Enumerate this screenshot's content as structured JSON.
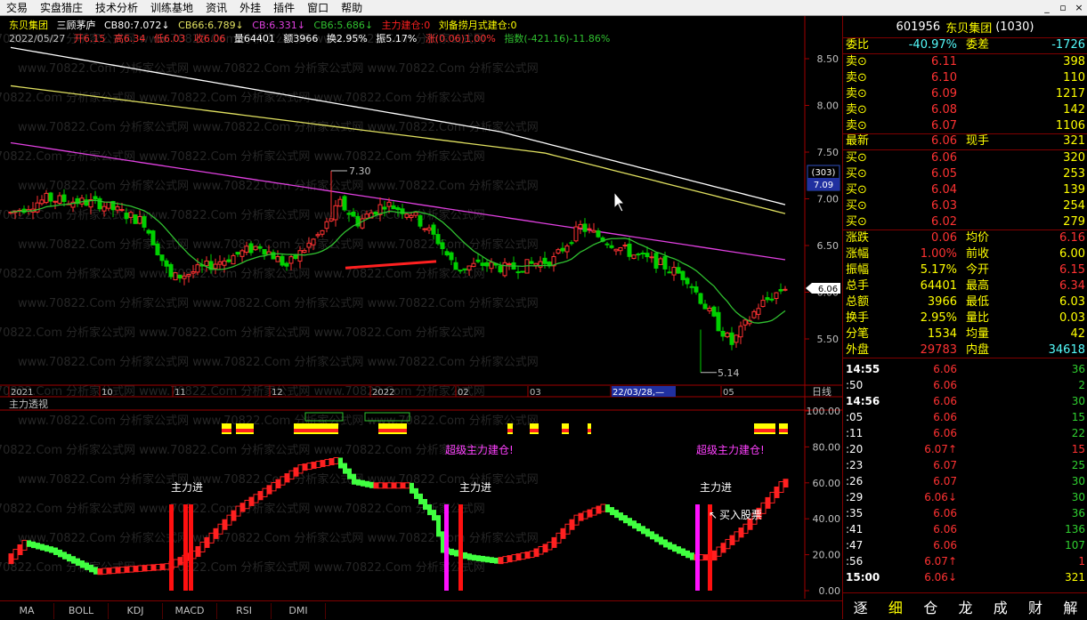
{
  "menu": [
    "交易",
    "实盘猎庄",
    "技术分析",
    "训练基地",
    "资讯",
    "外挂",
    "插件",
    "窗口",
    "帮助"
  ],
  "window_controls": [
    "_",
    "▫",
    "×"
  ],
  "info_line1": {
    "stock_name": "东贝集团",
    "indicator_name": "三顾茅庐",
    "cb80": "CB80:7.072↓",
    "cb66": "CB66:6.789↓",
    "cb": "CB:6.331↓",
    "cb6": "CB6:5.686↓",
    "zljc": "主力建仓:0",
    "lbj": "刘备捞月式建仓:0"
  },
  "info_line2": {
    "date": "2022/05/27",
    "open": "开6.15",
    "high": "高6.34",
    "low": "低6.03",
    "close": "收6.06",
    "vol": "量64401",
    "amount": "额3966",
    "turnover": "换2.95%",
    "amp": "振5.17%",
    "chg": "涨(0.06)1.00%",
    "index": "指数(-421.16)-11.86%"
  },
  "price_axis": [
    "8.50",
    "8.00",
    "7.50",
    "7.00",
    "6.50",
    "6.00",
    "5.50"
  ],
  "price_axis_values": [
    8.5,
    8.0,
    7.5,
    7.0,
    6.5,
    6.0,
    5.5
  ],
  "price_tag_box": {
    "top": "(303)",
    "bottom": "7.09"
  },
  "current_price_tag": "6.06",
  "annotations": {
    "high": "7.30",
    "low": "5.14"
  },
  "time_axis": [
    "2021",
    "10",
    "11",
    "12",
    "2022",
    "02",
    "03",
    "22/03/28,—",
    "05"
  ],
  "period_label": "日线",
  "indicator_title": "主力透视",
  "ind_axis": [
    "100.00",
    "80.00",
    "60.00",
    "40.00",
    "20.00",
    "0.00"
  ],
  "ind_axis_values": [
    100,
    80,
    60,
    40,
    20,
    0
  ],
  "ind_labels": {
    "zljin1": "主力进",
    "zljin2": "主力进",
    "zljin3": "主力进",
    "super1": "超级主力建仓!",
    "super2": "超级主力建仓!",
    "buy": "买入股票"
  },
  "watermark": "www.70822.Com 分析家公式网",
  "bottom_tabs": [
    "MA",
    "BOLL",
    "KDJ",
    "MACD",
    "RSI",
    "DMI"
  ],
  "stock_header": {
    "code": "601956",
    "name": "东贝集团",
    "num": "(1030)"
  },
  "quote": {
    "weibi_label": "委比",
    "weibi_val": "-40.97%",
    "weicha_label": "委差",
    "weicha_val": "-1726",
    "sells": [
      {
        "label": "卖⊙",
        "price": "6.11",
        "vol": "398"
      },
      {
        "label": "卖⊙",
        "price": "6.10",
        "vol": "110"
      },
      {
        "label": "卖⊙",
        "price": "6.09",
        "vol": "1217"
      },
      {
        "label": "卖⊙",
        "price": "6.08",
        "vol": "142"
      },
      {
        "label": "卖⊙",
        "price": "6.07",
        "vol": "1106"
      }
    ],
    "latest_label": "最新",
    "latest_val": "6.06",
    "xianshou_label": "现手",
    "xianshou_val": "321",
    "buys": [
      {
        "label": "买⊙",
        "price": "6.06",
        "vol": "320"
      },
      {
        "label": "买⊙",
        "price": "6.05",
        "vol": "253"
      },
      {
        "label": "买⊙",
        "price": "6.04",
        "vol": "139"
      },
      {
        "label": "买⊙",
        "price": "6.03",
        "vol": "254"
      },
      {
        "label": "买⊙",
        "price": "6.02",
        "vol": "279"
      }
    ],
    "stats": [
      {
        "l1": "涨跌",
        "v1": "0.06",
        "l2": "均价",
        "v2": "6.16"
      },
      {
        "l1": "涨幅",
        "v1": "1.00%",
        "l2": "前收",
        "v2": "6.00"
      },
      {
        "l1": "振幅",
        "v1": "5.17%",
        "l2": "今开",
        "v2": "6.15"
      },
      {
        "l1": "总手",
        "v1": "64401",
        "l2": "最高",
        "v2": "6.34"
      },
      {
        "l1": "总额",
        "v1": "3966",
        "l2": "最低",
        "v2": "6.03"
      },
      {
        "l1": "换手",
        "v1": "2.95%",
        "l2": "量比",
        "v2": "0.03"
      },
      {
        "l1": "分笔",
        "v1": "1534",
        "l2": "均量",
        "v2": "42"
      },
      {
        "l1": "外盘",
        "v1": "29783",
        "l2": "内盘",
        "v2": "34618"
      }
    ]
  },
  "ticks": [
    {
      "time": "14:55",
      "price": "6.06",
      "vol": "36",
      "dir": ""
    },
    {
      "time": ":50",
      "price": "6.06",
      "vol": "2",
      "dir": ""
    },
    {
      "time": "14:56",
      "price": "6.06",
      "vol": "30",
      "dir": ""
    },
    {
      "time": ":05",
      "price": "6.06",
      "vol": "15",
      "dir": ""
    },
    {
      "time": ":11",
      "price": "6.06",
      "vol": "22",
      "dir": ""
    },
    {
      "time": ":20",
      "price": "6.07↑",
      "vol": "15",
      "dir": "up"
    },
    {
      "time": ":23",
      "price": "6.07",
      "vol": "25",
      "dir": ""
    },
    {
      "time": ":26",
      "price": "6.07",
      "vol": "30",
      "dir": ""
    },
    {
      "time": ":29",
      "price": "6.06↓",
      "vol": "30",
      "dir": "down"
    },
    {
      "time": ":35",
      "price": "6.06",
      "vol": "36",
      "dir": ""
    },
    {
      "time": ":41",
      "price": "6.06",
      "vol": "136",
      "dir": ""
    },
    {
      "time": ":47",
      "price": "6.06",
      "vol": "107",
      "dir": ""
    },
    {
      "time": ":56",
      "price": "6.07↑",
      "vol": "1",
      "dir": "up"
    },
    {
      "time": "15:00",
      "price": "6.06↓",
      "vol": "321",
      "dir": "down"
    }
  ],
  "rp_bottom": [
    "逐",
    "细",
    "仓",
    "龙",
    "成",
    "财",
    "解"
  ],
  "colors": {
    "up": "#ff3232",
    "down": "#54fcfc",
    "bull": "#00d000",
    "yellow": "#ffff00",
    "ma_white": "#ffffff",
    "ma_yellow": "#e0e060",
    "ma_magenta": "#e040e0",
    "ma_green": "#30c030",
    "axis_red": "#a00000"
  }
}
